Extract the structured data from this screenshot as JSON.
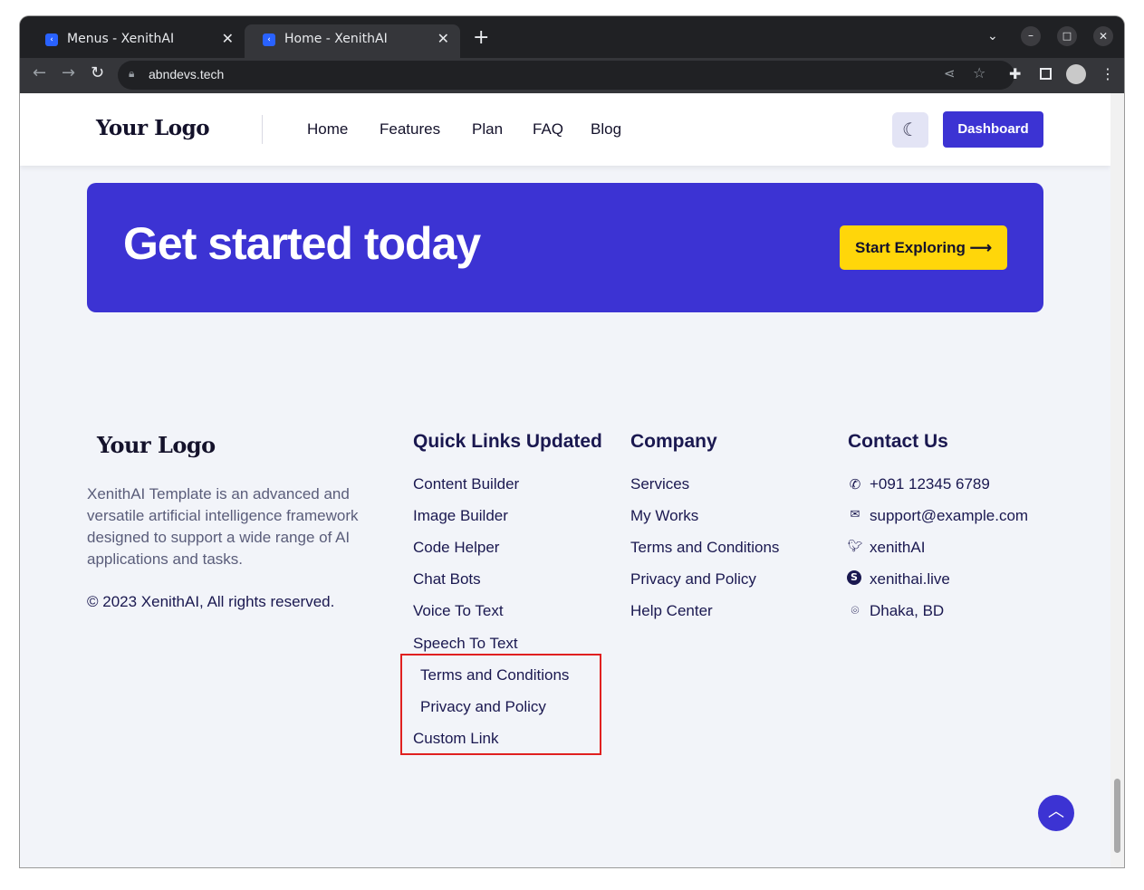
{
  "browser": {
    "tabs": [
      {
        "title": "Menus - XenithAI",
        "active": false
      },
      {
        "title": "Home - XenithAI",
        "active": true
      }
    ],
    "new_tab": "+",
    "url": "abndevs.tech"
  },
  "header": {
    "logo": "Your Logo",
    "nav": [
      "Home",
      "Features",
      "Plan",
      "FAQ",
      "Blog"
    ],
    "dashboard_label": "Dashboard"
  },
  "banner": {
    "title": "Get started today",
    "cta_label": "Start Exploring ⟶"
  },
  "footer": {
    "logo": "Your Logo",
    "description": "XenithAI Template is an advanced and versatile artificial intelligence framework designed to support a wide range of AI applications and tasks.",
    "copyright": "© 2023 XenithAI, All rights reserved.",
    "quick_links": {
      "heading": "Quick Links Updated",
      "items": [
        "Content Builder",
        "Image Builder",
        "Code Helper",
        "Chat Bots",
        "Voice To Text",
        "Speech To Text",
        "Terms and Conditions",
        "Privacy and Policy",
        "Custom Link"
      ]
    },
    "company": {
      "heading": "Company",
      "items": [
        "Services",
        "My Works",
        "Terms and Conditions",
        "Privacy and Policy",
        "Help Center"
      ]
    },
    "contact": {
      "heading": "Contact Us",
      "items": [
        {
          "icon": "phone-icon",
          "text": "+091 12345 6789"
        },
        {
          "icon": "mail-icon",
          "text": "support@example.com"
        },
        {
          "icon": "twitter-icon",
          "text": "xenithAI"
        },
        {
          "icon": "skype-icon",
          "text": "xenithai.live"
        },
        {
          "icon": "location-icon",
          "text": "Dhaka, BD"
        }
      ]
    }
  },
  "colors": {
    "accent": "#3c33d3",
    "cta": "#ffd60a",
    "highlight": "#e02020",
    "page_bg": "#f2f4f9"
  }
}
